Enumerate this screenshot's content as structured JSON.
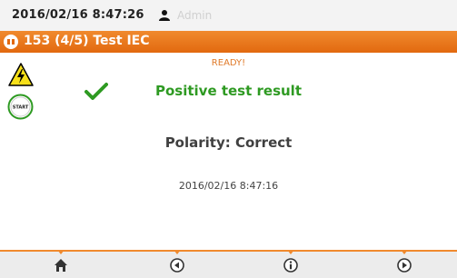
{
  "status_bar": {
    "datetime": "2016/02/16 8:47:26",
    "user": "Admin"
  },
  "title_bar": {
    "title": "153 (4/5) Test IEC"
  },
  "status": {
    "ready": "READY!"
  },
  "start_button": {
    "label": "START"
  },
  "result": {
    "message": "Positive test result",
    "polarity": "Polarity: Correct",
    "timestamp": "2016/02/16 8:47:16"
  },
  "nav": [
    {
      "icon": "home-icon"
    },
    {
      "icon": "back-icon"
    },
    {
      "icon": "info-icon"
    },
    {
      "icon": "forward-icon"
    }
  ],
  "colors": {
    "accent": "#f08a2e",
    "success": "#2e9a22",
    "ready": "#e07a2a",
    "user_text": "#d0d0d0"
  }
}
